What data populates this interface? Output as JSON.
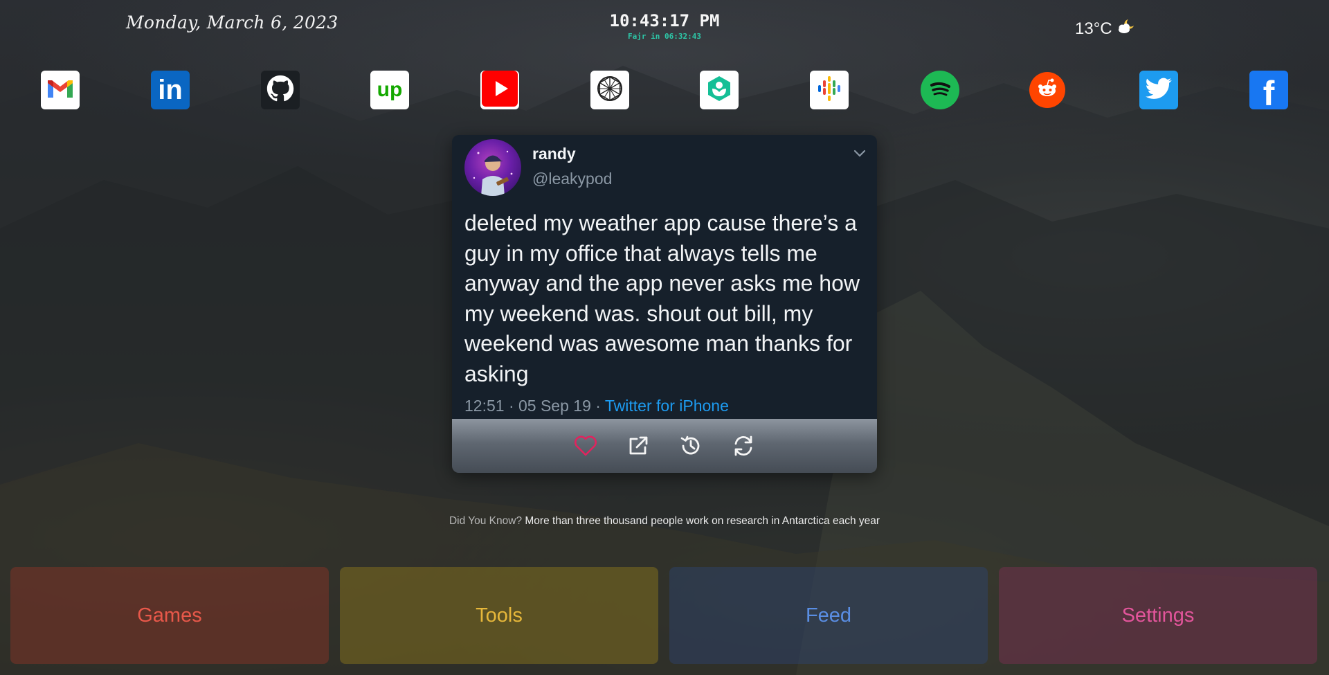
{
  "header": {
    "date": "Monday, March 6, 2023",
    "time": "10:43:17 PM",
    "prayer_countdown": "Fajr in 06:32:43",
    "temperature": "13°C",
    "weather_icon": "partly-cloudy-night-icon"
  },
  "shortcuts": [
    {
      "name": "gmail",
      "icon": "gmail-icon"
    },
    {
      "name": "linkedin",
      "icon": "linkedin-icon"
    },
    {
      "name": "github",
      "icon": "github-icon"
    },
    {
      "name": "upwork",
      "icon": "upwork-icon",
      "label": "up"
    },
    {
      "name": "youtube",
      "icon": "youtube-icon"
    },
    {
      "name": "openai",
      "icon": "openai-icon"
    },
    {
      "name": "khan-academy",
      "icon": "khan-academy-icon"
    },
    {
      "name": "google-podcasts",
      "icon": "google-podcasts-icon"
    },
    {
      "name": "spotify",
      "icon": "spotify-icon"
    },
    {
      "name": "reddit",
      "icon": "reddit-icon"
    },
    {
      "name": "twitter",
      "icon": "twitter-icon"
    },
    {
      "name": "facebook",
      "icon": "facebook-icon",
      "label": "f"
    }
  ],
  "tweet": {
    "author_name": "randy",
    "author_handle": "@leakypod",
    "text": "deleted my weather app cause there’s a guy in my office that always tells me anyway and the app never asks me how my weekend was. shout out bill, my weekend was awesome man thanks for asking",
    "timestamp": "12:51 · 05 Sep 19 · ",
    "source": "Twitter for iPhone",
    "actions": [
      "heart-icon",
      "external-link-icon",
      "history-icon",
      "refresh-icon"
    ]
  },
  "fact": {
    "label": "Did You Know?",
    "text": "More than three thousand people work on research in Antarctica each year"
  },
  "tiles": {
    "games": "Games",
    "tools": "Tools",
    "feed": "Feed",
    "settings": "Settings"
  },
  "colors": {
    "prayer": "#2dc7a8",
    "tweet_bg": "#16202b",
    "twitter_blue": "#1d9bf0",
    "games": "#e8584a",
    "tools": "#e6b73a",
    "feed": "#5a8ee4",
    "settings": "#e2559b"
  }
}
